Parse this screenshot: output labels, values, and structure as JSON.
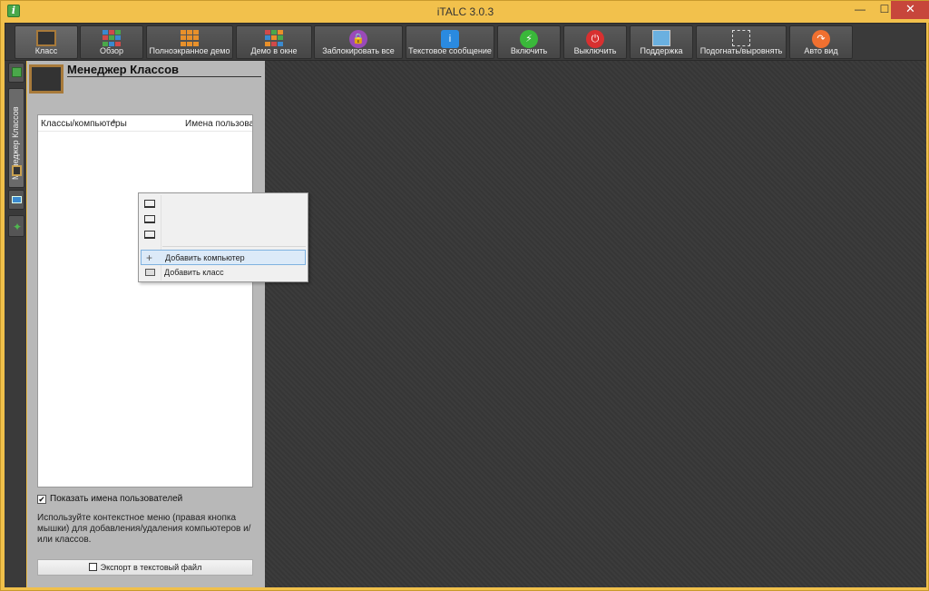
{
  "window": {
    "title": "iTALC 3.0.3",
    "controls": {
      "minimize": "—",
      "maximize": "☐",
      "close": "✕"
    }
  },
  "toolbar": {
    "buttons": [
      {
        "label": "Класс",
        "icon": "classroom-board-icon"
      },
      {
        "label": "Обзор",
        "icon": "overview-grid-icon"
      },
      {
        "label": "Полноэкранное демо",
        "icon": "fullscreen-demo-icon"
      },
      {
        "label": "Демо в окне",
        "icon": "window-demo-icon"
      },
      {
        "label": "Заблокировать все",
        "icon": "lock-icon"
      },
      {
        "label": "Текстовое сообщение",
        "icon": "info-message-icon"
      },
      {
        "label": "Включить",
        "icon": "power-on-icon"
      },
      {
        "label": "Выключить",
        "icon": "power-off-icon"
      },
      {
        "label": "Поддержка",
        "icon": "support-icon"
      },
      {
        "label": "Подогнать/выровнять",
        "icon": "fit-align-icon"
      },
      {
        "label": "Авто вид",
        "icon": "auto-view-icon"
      }
    ]
  },
  "sidebar": {
    "tab_label": "Менеджер Классов"
  },
  "panel": {
    "title": "Менеджер Классов",
    "columns": [
      "Классы/компьютеры",
      "Имена пользователей"
    ],
    "show_usernames_label": "Показать имена пользователей",
    "show_usernames_checked": true,
    "hint": "Используйте контекстное меню (правая кнопка мышки) для добавления/удаления компьютеров и/или классов.",
    "export_label": "Экспорт в текстовый файл"
  },
  "context_menu": {
    "items": [
      {
        "label": "Добавить компьютер",
        "highlighted": true
      },
      {
        "label": "Добавить класс",
        "highlighted": false
      }
    ]
  },
  "colors": {
    "window_frame": "#f0c04a",
    "close_button": "#c7463b",
    "toolbar_bg": "#3a3a3a",
    "main_bg": "#383838",
    "menu_highlight": "#dceaf8"
  }
}
